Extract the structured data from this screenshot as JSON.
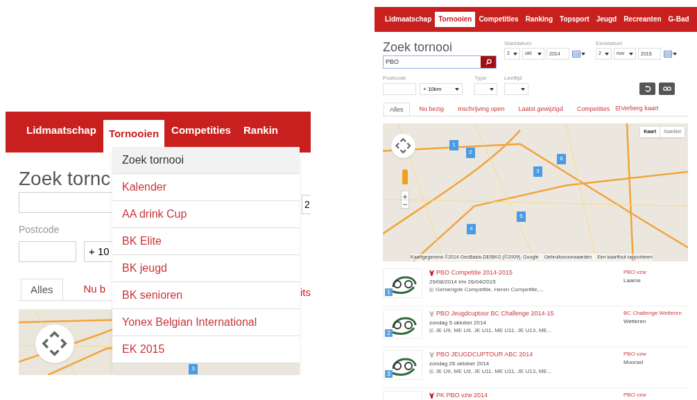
{
  "zoomed_view": {
    "nav": [
      {
        "label": "Lidmaatschap",
        "selected": false
      },
      {
        "label": "Tornooien",
        "selected": true
      },
      {
        "label": "Competities",
        "selected": false
      },
      {
        "label": "Rankin",
        "selected": false
      }
    ],
    "heading": "Zoek tornc",
    "postcode_label": "Postcode",
    "distance_select": "+ 10",
    "date_field": "2",
    "tabs": [
      {
        "label": "Alles",
        "selected": true
      },
      {
        "label": "Nu b",
        "selected": false
      }
    ],
    "tab_fragment": "its",
    "dropdown": [
      {
        "label": "Zoek tornooi",
        "selected": true
      },
      {
        "label": "Kalender",
        "selected": false
      },
      {
        "label": "AA drink Cup",
        "selected": false
      },
      {
        "label": "BK Elite",
        "selected": false
      },
      {
        "label": "BK jeugd",
        "selected": false
      },
      {
        "label": "BK senioren",
        "selected": false
      },
      {
        "label": "Yonex Belgian International",
        "selected": false
      },
      {
        "label": "EK 2015",
        "selected": false
      }
    ],
    "map_marker": "3"
  },
  "page": {
    "nav": [
      {
        "label": "Lidmaatschap",
        "selected": false
      },
      {
        "label": "Tornooien",
        "selected": true
      },
      {
        "label": "Competities",
        "selected": false
      },
      {
        "label": "Ranking",
        "selected": false
      },
      {
        "label": "Topsport",
        "selected": false
      },
      {
        "label": "Jeugd",
        "selected": false
      },
      {
        "label": "Recreanten",
        "selected": false
      },
      {
        "label": "G-Bad",
        "selected": false
      }
    ],
    "heading": "Zoek tornooi",
    "search": {
      "value": "PBO"
    },
    "start_date": {
      "label": "Startdatum",
      "day": "2",
      "month": "okt",
      "year": "2014"
    },
    "end_date": {
      "label": "Einddatum",
      "day": "2",
      "month": "nov",
      "year": "2015"
    },
    "postcode": {
      "label": "Postcode",
      "distance": "+ 10km"
    },
    "type": {
      "label": "Type"
    },
    "age": {
      "label": "Leeftijd"
    },
    "tabs": [
      {
        "label": "Alles",
        "selected": true
      },
      {
        "label": "Nu bezig",
        "selected": false
      },
      {
        "label": "Inschrijving open",
        "selected": false
      },
      {
        "label": "Laatst gewijzigd",
        "selected": false
      },
      {
        "label": "Competities",
        "selected": false
      }
    ],
    "hide_map": "⊟Verberg kaart",
    "map": {
      "types": [
        {
          "label": "Kaart",
          "selected": true
        },
        {
          "label": "Satelliet",
          "selected": false
        }
      ],
      "markers": [
        "1",
        "2",
        "3",
        "4",
        "5",
        "6"
      ],
      "attribution": "Kaartgegevens ©2014 GeoBasis-DE/BKG (©2009), Google",
      "terms": "Gebruiksvoorwaarden",
      "report": "Een kaartfout rapporteren"
    },
    "results": [
      {
        "badge": "1",
        "flag_active": true,
        "title": "PBO Competitie 2014-2015",
        "date": "29/08/2014 t/m 26/04/2015",
        "categories": "Gemengde Competitie, Heren Competitie,...",
        "organizer": "PBO vzw",
        "location": "Laarne"
      },
      {
        "badge": "2",
        "flag_active": false,
        "title": "PBO Jeugdcuptour BC Challenge 2014-15",
        "date": "zondag 5 oktober 2014",
        "categories": "JE U9, ME U9, JE U11, ME U11, JE U13, ME...",
        "organizer": "BC Challenge Wetteren",
        "location": "Wetteren"
      },
      {
        "badge": "3",
        "flag_active": false,
        "title": "PBO JEUGDCUPTOUR ABC 2014",
        "date": "zondag 26 oktober 2014",
        "categories": "JE U9, ME U9, JE U11, ME U11, JE U13, ME...",
        "organizer": "PBO vzw",
        "location": "Moorsel"
      },
      {
        "flag_active": true,
        "title": "PK PBO vzw 2014",
        "organizer": "PBO vzw"
      }
    ]
  }
}
